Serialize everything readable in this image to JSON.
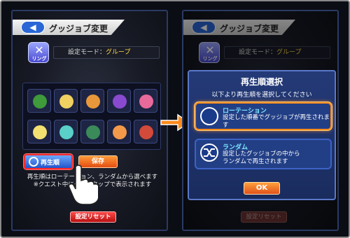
{
  "left_panel": {
    "back_label": "◀",
    "title": "グッジョブ変更",
    "ring_label": "リング",
    "mode_label": "設定モード：",
    "mode_value": "グループ",
    "rotation_btn": "再生順",
    "random_btn": "保存",
    "info_line1": "再生順はローテーション、ランダムから選べます",
    "info_line2": "※クエスト中にダブルタップで表示されます",
    "reset_btn": "設定リセット",
    "grid_colors": [
      "#3e9a3a",
      "#f0d060",
      "#e8983a",
      "#8a4acf",
      "#e86a9a",
      "#f2e070",
      "#5ad0c8",
      "#3a8a5a",
      "#f29a4a",
      "#d24a3a"
    ]
  },
  "right_panel": {
    "back_label": "◀",
    "title": "グッジョブ変更",
    "ring_label": "リング",
    "mode_label": "設定モード：",
    "mode_value": "グループ",
    "dialog_title": "再生順選択",
    "dialog_sub": "以下より再生順を選択してください",
    "opt1_name": "ローテーション",
    "opt1_desc": "設定した順番でグッジョブが再生されます",
    "opt2_name": "ランダム",
    "opt2_desc1": "設定したグッジョブの中から",
    "opt2_desc2": "ランダムで再生されます",
    "ok_btn": "OK",
    "reset_btn": "設定リセット"
  },
  "colors": {
    "accent_orange": "#ff8a1a",
    "highlight_red": "#ff2a2a",
    "dialog_blue": "#243a78"
  }
}
